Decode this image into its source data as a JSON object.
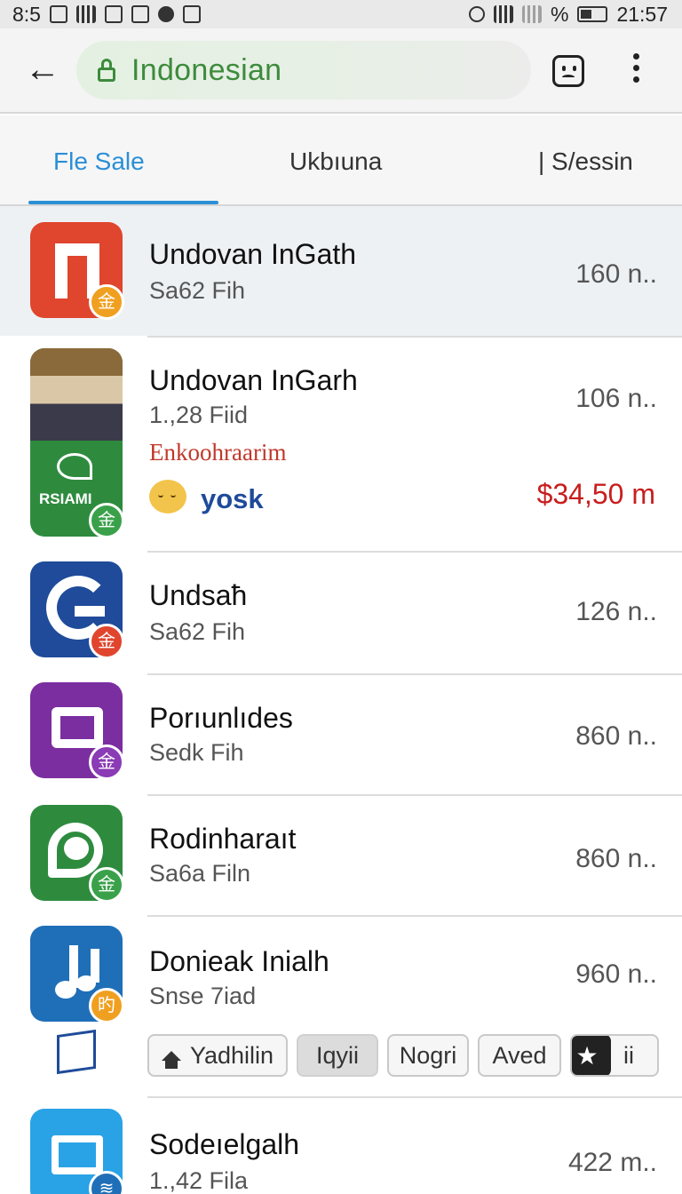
{
  "status_bar": {
    "left_time": "8:5",
    "right_time": "21:57",
    "battery_symbol": "%"
  },
  "app_bar": {
    "url_text": "Indonesian",
    "back_icon": "arrow-left-icon",
    "account_icon": "face-icon",
    "menu_icon": "more-vert-icon"
  },
  "tabs": [
    {
      "label": "Fle Sale",
      "active": true
    },
    {
      "label": "Ukbıuna",
      "active": false
    },
    {
      "label": "| S/essin",
      "active": false
    }
  ],
  "colors": {
    "accent": "#2b8fd6",
    "url_green": "#3d8b3d",
    "price_red": "#c81e1e"
  },
  "items": [
    {
      "title": "Undovan InGath",
      "subtitle": "Sa62 Fih",
      "meta": "160 n..",
      "icon_color": "#e0452e",
      "badge_color": "#f0a020",
      "badge_glyph": "金"
    },
    {
      "title": "Undovan InGarh",
      "subtitle": "1.,28 Fiid",
      "meta": "106 n..",
      "promo": "Enkoohraarim",
      "brand": "yosk",
      "price": "$34,50 m",
      "icon_text": "RSIAMI",
      "icon_color": "#2e8b3e",
      "badge_color": "#3aa14a",
      "badge_glyph": "金"
    },
    {
      "title": "Undsaħ",
      "subtitle": "Sa62 Fih",
      "meta": "126 n..",
      "icon_color": "#1f4b9a",
      "badge_color": "#e0452e",
      "badge_glyph": "金"
    },
    {
      "title": "Porıunlıdes",
      "subtitle": "Sedk Fih",
      "meta": "860 n..",
      "icon_color": "#7b2ea0",
      "badge_color": "#8a3bb5",
      "badge_glyph": "金"
    },
    {
      "title": "Rodinharaıt",
      "subtitle": "Sa6a Filn",
      "meta": "860 n..",
      "icon_color": "#2e8b3e",
      "badge_color": "#3aa14a",
      "badge_glyph": "金"
    },
    {
      "title": "Donieak Inialh",
      "subtitle": "Snse 7iad",
      "meta": "960 n..",
      "icon_color": "#1f6fb8",
      "badge_color": "#f0a020",
      "badge_glyph": "旳",
      "chips": [
        "Yadhilin",
        "Iqyii",
        "Nogri",
        "Aved",
        "ii"
      ]
    },
    {
      "title": "Sodeıelgalh",
      "subtitle": "1.,42 Fila",
      "meta": "422 m..",
      "icon_color": "#2aa3e6",
      "badge_color": "#1f6fb8",
      "badge_glyph": "≋"
    }
  ]
}
